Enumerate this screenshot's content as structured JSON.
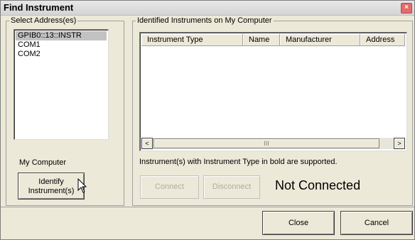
{
  "window": {
    "title": "Find Instrument",
    "close_symbol": "×"
  },
  "select_address": {
    "legend": "Select Address(es)",
    "items": [
      {
        "label": "GPIB0::13::INSTR",
        "selected": true
      },
      {
        "label": "COM1",
        "selected": false
      },
      {
        "label": "COM2",
        "selected": false
      }
    ],
    "my_computer_label": "My Computer",
    "identify_button": {
      "line1": "Identify",
      "line2": "Instrument(s)"
    }
  },
  "identified": {
    "legend": "Identified Instruments on My Computer",
    "columns": [
      "Instrument Type",
      "Name",
      "Manufacturer",
      "Address"
    ],
    "scroll": {
      "left_arrow": "<",
      "right_arrow": ">",
      "thumb_grip": "III"
    },
    "note": "Instrument(s) with Instrument Type in bold are supported.",
    "connect_label": "Connect",
    "disconnect_label": "Disconnect",
    "status": "Not Connected"
  },
  "footer": {
    "close_label": "Close",
    "cancel_label": "Cancel"
  }
}
